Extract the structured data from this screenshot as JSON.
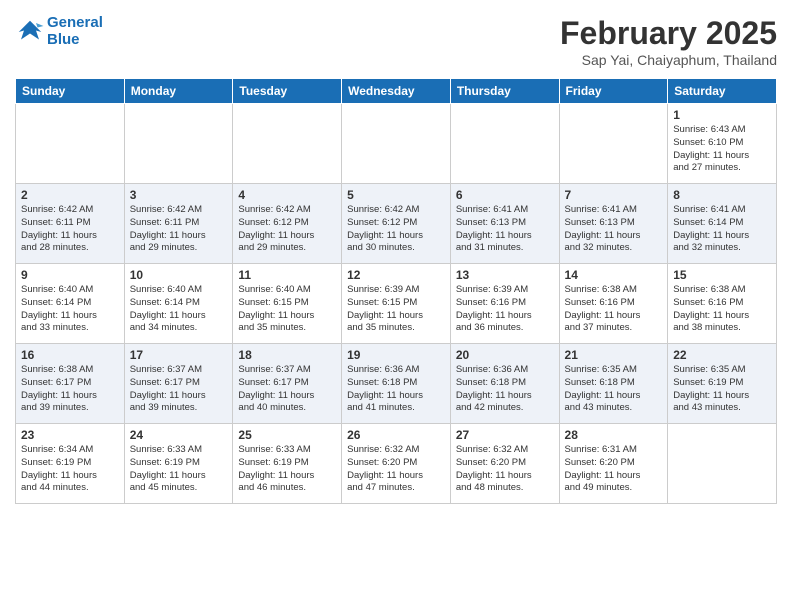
{
  "header": {
    "logo_line1": "General",
    "logo_line2": "Blue",
    "month_title": "February 2025",
    "subtitle": "Sap Yai, Chaiyaphum, Thailand"
  },
  "weekdays": [
    "Sunday",
    "Monday",
    "Tuesday",
    "Wednesday",
    "Thursday",
    "Friday",
    "Saturday"
  ],
  "days": [
    {
      "num": "",
      "info": ""
    },
    {
      "num": "",
      "info": ""
    },
    {
      "num": "",
      "info": ""
    },
    {
      "num": "",
      "info": ""
    },
    {
      "num": "",
      "info": ""
    },
    {
      "num": "",
      "info": ""
    },
    {
      "num": "1",
      "info": "Sunrise: 6:43 AM\nSunset: 6:10 PM\nDaylight: 11 hours\nand 27 minutes."
    },
    {
      "num": "2",
      "info": "Sunrise: 6:42 AM\nSunset: 6:11 PM\nDaylight: 11 hours\nand 28 minutes."
    },
    {
      "num": "3",
      "info": "Sunrise: 6:42 AM\nSunset: 6:11 PM\nDaylight: 11 hours\nand 29 minutes."
    },
    {
      "num": "4",
      "info": "Sunrise: 6:42 AM\nSunset: 6:12 PM\nDaylight: 11 hours\nand 29 minutes."
    },
    {
      "num": "5",
      "info": "Sunrise: 6:42 AM\nSunset: 6:12 PM\nDaylight: 11 hours\nand 30 minutes."
    },
    {
      "num": "6",
      "info": "Sunrise: 6:41 AM\nSunset: 6:13 PM\nDaylight: 11 hours\nand 31 minutes."
    },
    {
      "num": "7",
      "info": "Sunrise: 6:41 AM\nSunset: 6:13 PM\nDaylight: 11 hours\nand 32 minutes."
    },
    {
      "num": "8",
      "info": "Sunrise: 6:41 AM\nSunset: 6:14 PM\nDaylight: 11 hours\nand 32 minutes."
    },
    {
      "num": "9",
      "info": "Sunrise: 6:40 AM\nSunset: 6:14 PM\nDaylight: 11 hours\nand 33 minutes."
    },
    {
      "num": "10",
      "info": "Sunrise: 6:40 AM\nSunset: 6:14 PM\nDaylight: 11 hours\nand 34 minutes."
    },
    {
      "num": "11",
      "info": "Sunrise: 6:40 AM\nSunset: 6:15 PM\nDaylight: 11 hours\nand 35 minutes."
    },
    {
      "num": "12",
      "info": "Sunrise: 6:39 AM\nSunset: 6:15 PM\nDaylight: 11 hours\nand 35 minutes."
    },
    {
      "num": "13",
      "info": "Sunrise: 6:39 AM\nSunset: 6:16 PM\nDaylight: 11 hours\nand 36 minutes."
    },
    {
      "num": "14",
      "info": "Sunrise: 6:38 AM\nSunset: 6:16 PM\nDaylight: 11 hours\nand 37 minutes."
    },
    {
      "num": "15",
      "info": "Sunrise: 6:38 AM\nSunset: 6:16 PM\nDaylight: 11 hours\nand 38 minutes."
    },
    {
      "num": "16",
      "info": "Sunrise: 6:38 AM\nSunset: 6:17 PM\nDaylight: 11 hours\nand 39 minutes."
    },
    {
      "num": "17",
      "info": "Sunrise: 6:37 AM\nSunset: 6:17 PM\nDaylight: 11 hours\nand 39 minutes."
    },
    {
      "num": "18",
      "info": "Sunrise: 6:37 AM\nSunset: 6:17 PM\nDaylight: 11 hours\nand 40 minutes."
    },
    {
      "num": "19",
      "info": "Sunrise: 6:36 AM\nSunset: 6:18 PM\nDaylight: 11 hours\nand 41 minutes."
    },
    {
      "num": "20",
      "info": "Sunrise: 6:36 AM\nSunset: 6:18 PM\nDaylight: 11 hours\nand 42 minutes."
    },
    {
      "num": "21",
      "info": "Sunrise: 6:35 AM\nSunset: 6:18 PM\nDaylight: 11 hours\nand 43 minutes."
    },
    {
      "num": "22",
      "info": "Sunrise: 6:35 AM\nSunset: 6:19 PM\nDaylight: 11 hours\nand 43 minutes."
    },
    {
      "num": "23",
      "info": "Sunrise: 6:34 AM\nSunset: 6:19 PM\nDaylight: 11 hours\nand 44 minutes."
    },
    {
      "num": "24",
      "info": "Sunrise: 6:33 AM\nSunset: 6:19 PM\nDaylight: 11 hours\nand 45 minutes."
    },
    {
      "num": "25",
      "info": "Sunrise: 6:33 AM\nSunset: 6:19 PM\nDaylight: 11 hours\nand 46 minutes."
    },
    {
      "num": "26",
      "info": "Sunrise: 6:32 AM\nSunset: 6:20 PM\nDaylight: 11 hours\nand 47 minutes."
    },
    {
      "num": "27",
      "info": "Sunrise: 6:32 AM\nSunset: 6:20 PM\nDaylight: 11 hours\nand 48 minutes."
    },
    {
      "num": "28",
      "info": "Sunrise: 6:31 AM\nSunset: 6:20 PM\nDaylight: 11 hours\nand 49 minutes."
    },
    {
      "num": "",
      "info": ""
    }
  ]
}
